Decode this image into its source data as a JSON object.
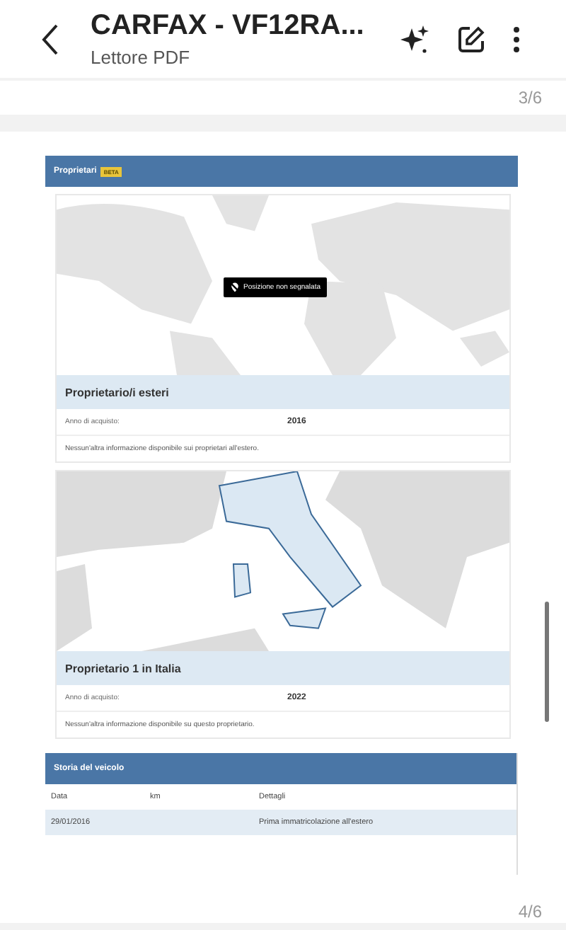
{
  "app_bar": {
    "title": "CARFAX - VF12RA...",
    "subtitle": "Lettore PDF"
  },
  "pages": [
    {
      "number": "3/6"
    },
    {
      "number": "4/6"
    }
  ],
  "owners_section": {
    "title": "Proprietari",
    "badge": "BETA",
    "owners": [
      {
        "heading": "Proprietario/i esteri",
        "map_overlay": "Posizione non segnalata",
        "label": "Anno di acquisto:",
        "year": "2016",
        "note": "Nessun'altra informazione disponibile sui proprietari all'estero."
      },
      {
        "heading": "Proprietario 1 in Italia",
        "label": "Anno di acquisto:",
        "year": "2022",
        "note": "Nessun'altra informazione disponibile su questo proprietario."
      }
    ]
  },
  "history": {
    "title": "Storia del veicolo",
    "columns": [
      "Data",
      "km",
      "Dettagli"
    ],
    "rows": [
      [
        "29/01/2016",
        "",
        "Prima immatricolazione all'estero"
      ]
    ]
  }
}
